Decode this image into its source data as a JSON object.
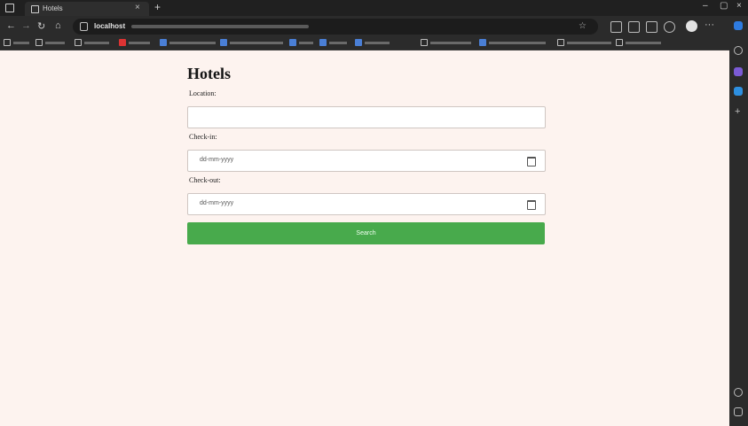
{
  "browser": {
    "tab_title": "Hotels",
    "url_host": "localhost"
  },
  "page": {
    "title": "Hotels",
    "location": {
      "label": "Location:",
      "value": ""
    },
    "checkin": {
      "label": "Check-in:",
      "placeholder": "dd-mm-yyyy"
    },
    "checkout": {
      "label": "Check-out:",
      "placeholder": "dd-mm-yyyy"
    },
    "search_button": "Search"
  },
  "colors": {
    "page_background": "#fdf3ef",
    "button_green": "#48aa4c",
    "browser_dark": "#2b2b2b"
  },
  "icons": [
    "back-icon",
    "forward-icon",
    "reload-icon",
    "home-icon",
    "lock-icon",
    "star-icon",
    "calendar-icon",
    "profile-icon",
    "more-icon"
  ]
}
